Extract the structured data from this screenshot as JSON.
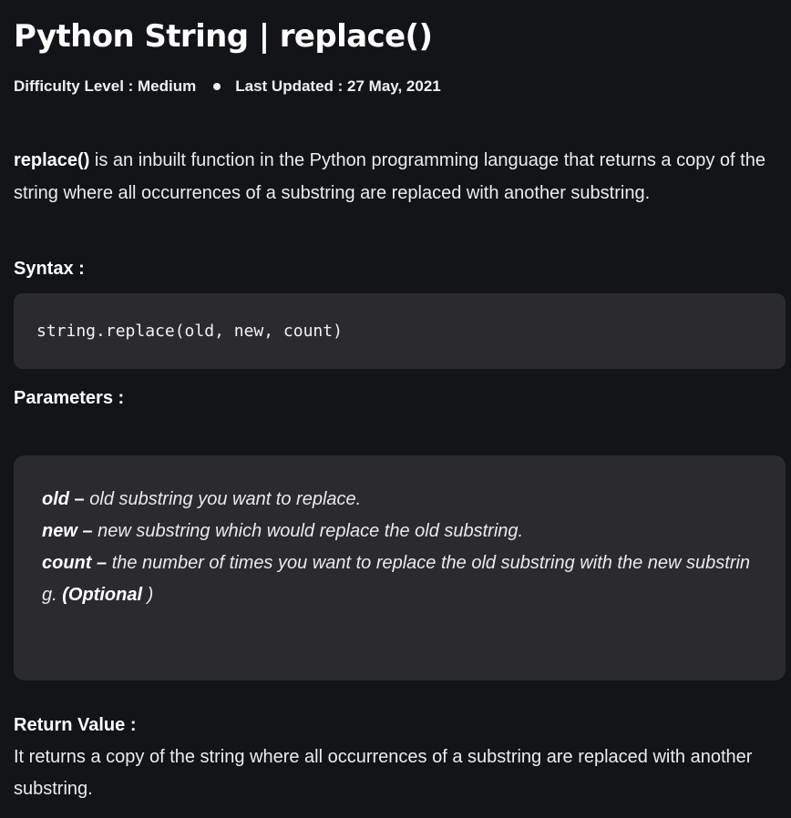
{
  "article": {
    "title": "Python String | replace()",
    "difficulty": "Difficulty Level : Medium",
    "last_updated": "Last Updated : 27 May, 2021"
  },
  "intro": {
    "function_name": "replace()",
    "text": " is an inbuilt function in the Python programming language that returns a copy of the string where all occurrences of a substring are replaced with another substring."
  },
  "syntax": {
    "heading": "Syntax :",
    "code": "string.replace(old, new, count)"
  },
  "parameters": {
    "heading": "Parameters :",
    "items": [
      {
        "name": "old",
        "separator": " – ",
        "description": "old substring you want to replace."
      },
      {
        "name": "new",
        "separator": " – ",
        "description": "new substring which would replace the old substring."
      },
      {
        "name": "count",
        "separator": " – ",
        "description": "the number of times you want to replace the old substring with the new substring. ",
        "optional_label": "(Optional",
        "optional_close": " )"
      }
    ]
  },
  "return_value": {
    "heading": "Return Value :",
    "text": "It returns a copy of the string where all occurrences of a substring are replaced with another substring."
  },
  "colors": {
    "background": "#131417",
    "code_box_background": "#2b2b2e",
    "text": "#ececec"
  }
}
